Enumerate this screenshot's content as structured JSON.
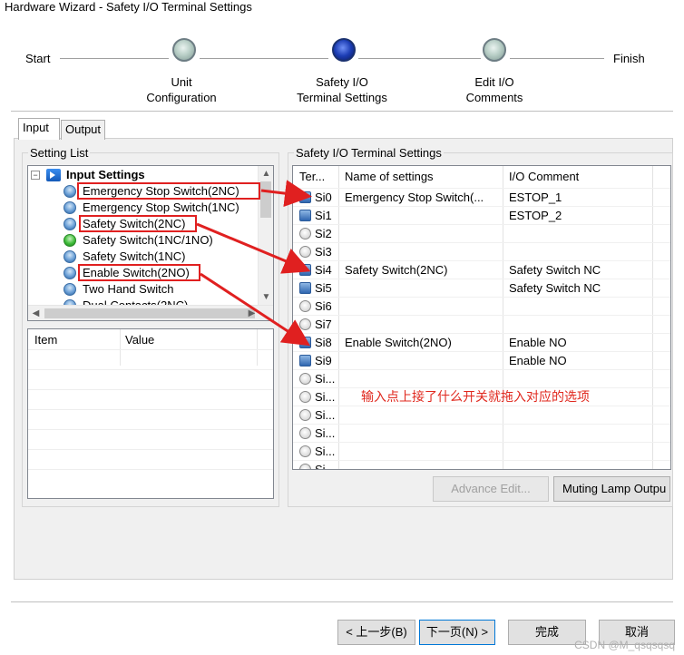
{
  "window": {
    "title": "Hardware Wizard - Safety I/O Terminal Settings"
  },
  "wizard": {
    "start_label": "Start",
    "finish_label": "Finish",
    "steps": [
      {
        "label_line1": "Unit",
        "label_line2": "Configuration",
        "state": "inactive"
      },
      {
        "label_line1": "Safety I/O",
        "label_line2": "Terminal Settings",
        "state": "active"
      },
      {
        "label_line1": "Edit I/O",
        "label_line2": "Comments",
        "state": "inactive"
      }
    ]
  },
  "tabs": [
    {
      "label": "Input",
      "selected": true
    },
    {
      "label": "Output",
      "selected": false
    }
  ],
  "setting_list": {
    "title": "Setting List",
    "root_label": "Input Settings",
    "items": [
      {
        "label": "Emergency Stop Switch(2NC)",
        "icon": "blue"
      },
      {
        "label": "Emergency Stop Switch(1NC)",
        "icon": "blue"
      },
      {
        "label": "Safety Switch(2NC)",
        "icon": "blue"
      },
      {
        "label": "Safety Switch(1NC/1NO)",
        "icon": "green"
      },
      {
        "label": "Safety Switch(1NC)",
        "icon": "blue"
      },
      {
        "label": "Enable Switch(2NO)",
        "icon": "blue"
      },
      {
        "label": "Two Hand Switch",
        "icon": "blue"
      },
      {
        "label": "Dual Contacts(2NC)",
        "icon": "blue"
      }
    ]
  },
  "properties": {
    "col_item": "Item",
    "col_value": "Value"
  },
  "terminal_settings": {
    "title": "Safety I/O Terminal Settings",
    "col_terminal": "Ter...",
    "col_name": "Name of settings",
    "col_comment": "I/O Comment",
    "rows": [
      {
        "terminal": "Si0",
        "name": "Emergency Stop Switch(...",
        "comment": "ESTOP_1",
        "icon": "blue"
      },
      {
        "terminal": "Si1",
        "name": "",
        "comment": "ESTOP_2",
        "icon": "blue"
      },
      {
        "terminal": "Si2",
        "name": "",
        "comment": "",
        "icon": "empty"
      },
      {
        "terminal": "Si3",
        "name": "",
        "comment": "",
        "icon": "empty"
      },
      {
        "terminal": "Si4",
        "name": "Safety Switch(2NC)",
        "comment": "Safety Switch NC",
        "icon": "blue"
      },
      {
        "terminal": "Si5",
        "name": "",
        "comment": "Safety Switch NC",
        "icon": "blue"
      },
      {
        "terminal": "Si6",
        "name": "",
        "comment": "",
        "icon": "empty"
      },
      {
        "terminal": "Si7",
        "name": "",
        "comment": "",
        "icon": "empty"
      },
      {
        "terminal": "Si8",
        "name": "Enable Switch(2NO)",
        "comment": "Enable NO",
        "icon": "blue"
      },
      {
        "terminal": "Si9",
        "name": "",
        "comment": "Enable NO",
        "icon": "blue"
      },
      {
        "terminal": "Si...",
        "name": "",
        "comment": "",
        "icon": "empty"
      },
      {
        "terminal": "Si...",
        "name": "",
        "comment": "",
        "icon": "empty"
      },
      {
        "terminal": "Si...",
        "name": "",
        "comment": "",
        "icon": "empty"
      },
      {
        "terminal": "Si...",
        "name": "",
        "comment": "",
        "icon": "empty"
      },
      {
        "terminal": "Si...",
        "name": "",
        "comment": "",
        "icon": "empty"
      },
      {
        "terminal": "Si...",
        "name": "",
        "comment": "",
        "icon": "empty"
      }
    ]
  },
  "buttons": {
    "advance_edit": "Advance Edit...",
    "muting_lamp": "Muting Lamp Outpu",
    "back": "< 上一步(B)",
    "next": "下一页(N) >",
    "finish": "完成",
    "cancel": "取消"
  },
  "annotation": {
    "text": "输入点上接了什么开关就拖入对应的选项"
  },
  "watermark": {
    "text": "CSDN @M_qsqsqsq"
  },
  "colors": {
    "annotation_red": "#e0281e",
    "active_step": "#1c3db4"
  }
}
